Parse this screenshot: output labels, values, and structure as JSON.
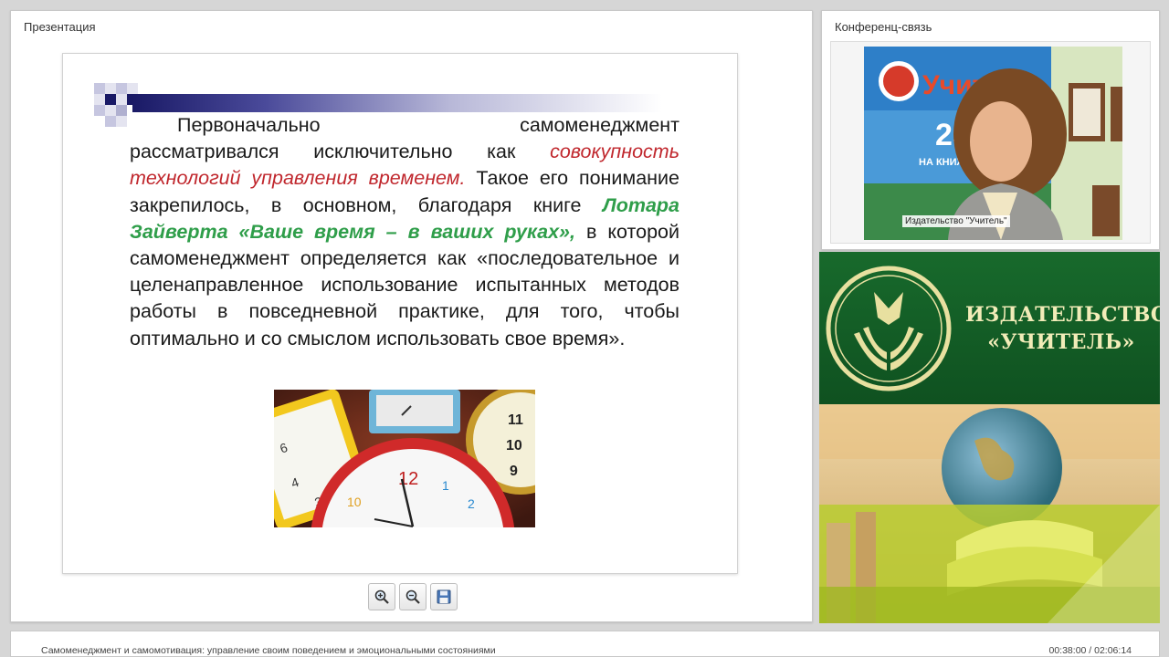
{
  "presentation": {
    "title": "Презентация",
    "slide": {
      "line1_a": "Первоначально",
      "line1_b": "самоменеджмент",
      "text_1": "рассматривался исключительно как ",
      "red_1": "совокупность технологий управления временем",
      "red_dot": ".",
      "text_2": " Такое его понимание закрепилось, в основном, благодаря книге ",
      "green_1": "Лотара Зайверта «Ваше время – в ваших руках»,",
      "text_3": " в которой самоменеджмент определяется как «последовательное и целенаправленное использование испытанных методов работы в повседневной практике, для того, чтобы оптимально и со смыслом использовать свое время».",
      "image_alt": "clocks-photo"
    },
    "toolbar": {
      "zoom_in_icon": "zoom-in-icon",
      "zoom_out_icon": "zoom-out-icon",
      "save_icon": "save-icon"
    }
  },
  "conference": {
    "title": "Конференц-связь",
    "video_caption": "Издательство \"Учитель\""
  },
  "ad": {
    "title_line1": "ИЗДАТЕЛЬСТВО",
    "title_line2": "«УЧИТЕЛЬ»"
  },
  "footer": {
    "course_title": "Самоменеджмент и самомотивация: управление своим поведением и эмоциональными состояниями",
    "time": "00:38:00 / 02:06:14"
  },
  "colors": {
    "accent_red": "#c0272d",
    "accent_green": "#2f9e4a",
    "brand_green": "#186a2c"
  }
}
